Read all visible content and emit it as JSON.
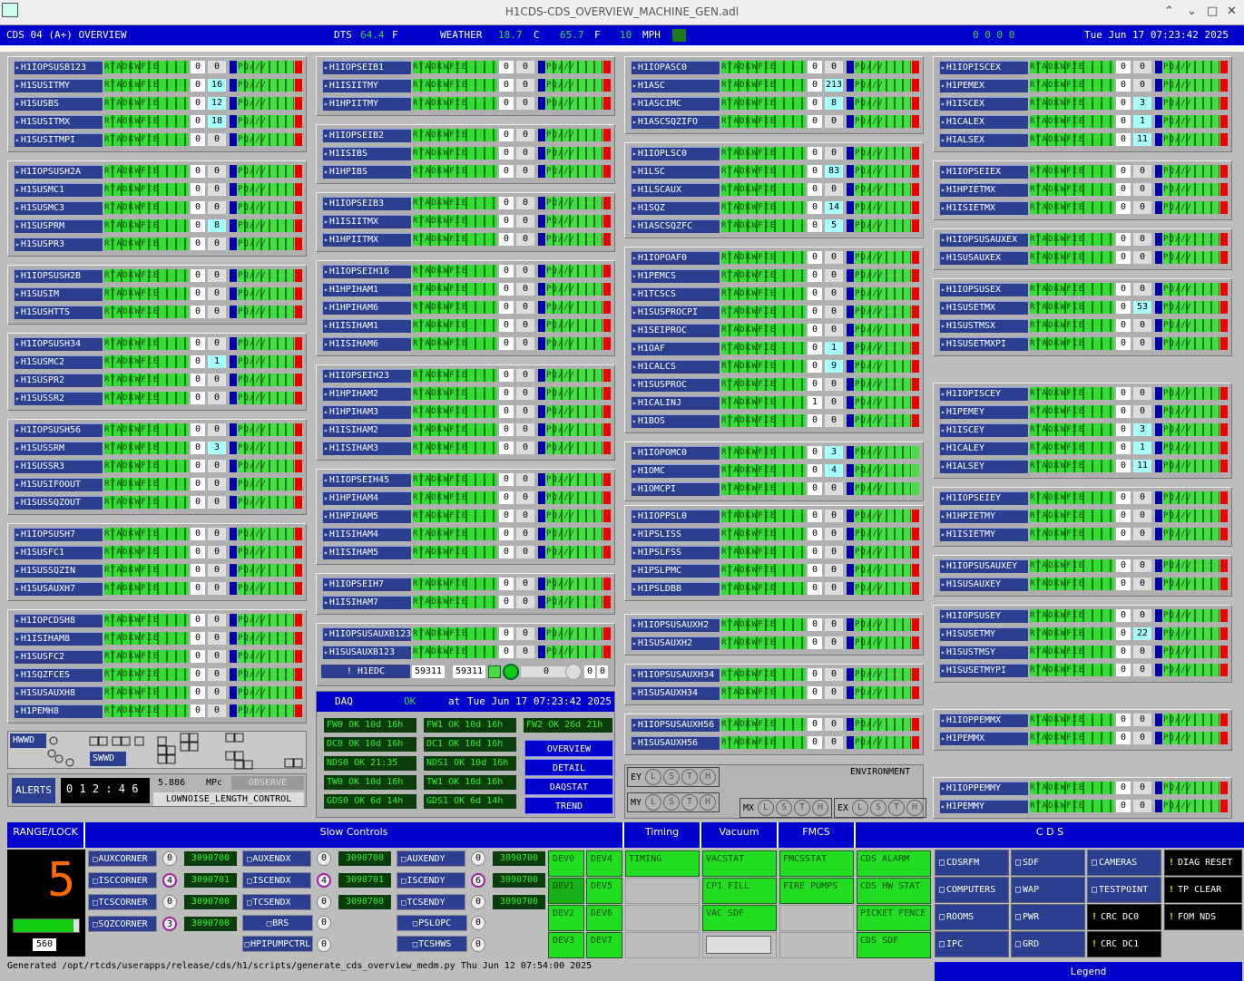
{
  "window": {
    "title": "H1CDS-CDS_OVERVIEW_MACHINE_GEN.adl",
    "ctrl": [
      "⌃",
      "⌄",
      "□",
      "✕"
    ]
  },
  "header": {
    "title": "CDS 04 (A+) OVERVIEW",
    "dts_label": "DTS",
    "dts_val": "64.4",
    "dts_unit": "F",
    "weather_label": "WEATHER",
    "w_c": "18.7",
    "w_c_unit": "C",
    "w_f": "65.7",
    "w_f_unit": "F",
    "wind": "10",
    "wind_unit": "MPH",
    "zeros": "0   0   0   0",
    "datetime": "Tue Jun 17 07:23:42 2025"
  },
  "status_letters": "RTADKWFIE",
  "daq_letters": "PQ///",
  "columns": [
    [
      {
        "rows": [
          [
            "H1IOPSUSB123",
            "0",
            "0"
          ],
          [
            "H1SUSITMY",
            "0",
            "16"
          ],
          [
            "H1SUSBS",
            "0",
            "12"
          ],
          [
            "H1SUSITMX",
            "0",
            "18"
          ],
          [
            "H1SUSITMPI",
            "0",
            "0"
          ]
        ]
      },
      {
        "rows": [
          [
            "H1IOPSUSH2A",
            "0",
            "0"
          ],
          [
            "H1SUSMC1",
            "0",
            "0"
          ],
          [
            "H1SUSMC3",
            "0",
            "0"
          ],
          [
            "H1SUSPRM",
            "0",
            "8"
          ],
          [
            "H1SUSPR3",
            "0",
            "0"
          ]
        ]
      },
      {
        "rows": [
          [
            "H1IOPSUSH2B",
            "0",
            "0"
          ],
          [
            "H1SUSIM",
            "0",
            "0"
          ],
          [
            "H1SUSHTTS",
            "0",
            "0"
          ]
        ]
      },
      {
        "rows": [
          [
            "H1IOPSUSH34",
            "0",
            "0"
          ],
          [
            "H1SUSMC2",
            "0",
            "1"
          ],
          [
            "H1SUSPR2",
            "0",
            "0"
          ],
          [
            "H1SUSSR2",
            "0",
            "0"
          ]
        ]
      },
      {
        "rows": [
          [
            "H1IOPSUSH56",
            "0",
            "0"
          ],
          [
            "H1SUSSRM",
            "0",
            "3"
          ],
          [
            "H1SUSSR3",
            "0",
            "0"
          ],
          [
            "H1SUSIFOOUT",
            "0",
            "0"
          ],
          [
            "H1SUSSQZOUT",
            "0",
            "0"
          ]
        ]
      },
      {
        "rows": [
          [
            "H1IOPSUSH7",
            "0",
            "0"
          ],
          [
            "H1SUSFC1",
            "0",
            "0"
          ],
          [
            "H1SUSSQZIN",
            "0",
            "0"
          ],
          [
            "H1SUSAUXH7",
            "0",
            "0"
          ]
        ]
      },
      {
        "rows": [
          [
            "H1IOPCDSH8",
            "0",
            "0"
          ],
          [
            "H1ISIHAM8",
            "0",
            "0"
          ],
          [
            "H1SUSFC2",
            "0",
            "0"
          ],
          [
            "H1SQZFCES",
            "0",
            "0"
          ],
          [
            "H1SUSAUXH8",
            "0",
            "0"
          ],
          [
            "H1PEMH8",
            "0",
            "0"
          ]
        ]
      }
    ],
    [
      {
        "rows": [
          [
            "H1IOPSEIB1",
            "0",
            "0"
          ],
          [
            "H1ISIITMY",
            "0",
            "0"
          ],
          [
            "H1HPIITMY",
            "0",
            "0"
          ]
        ]
      },
      {
        "rows": [
          [
            "H1IOPSEIB2",
            "0",
            "0"
          ],
          [
            "H1ISIBS",
            "0",
            "0"
          ],
          [
            "H1HPIBS",
            "0",
            "0"
          ]
        ]
      },
      {
        "rows": [
          [
            "H1IOPSEIB3",
            "0",
            "0"
          ],
          [
            "H1ISIITMX",
            "0",
            "0"
          ],
          [
            "H1HPIITMX",
            "0",
            "0"
          ]
        ]
      },
      {
        "rows": [
          [
            "H1IOPSEIH16",
            "0",
            "0"
          ],
          [
            "H1HPIHAM1",
            "0",
            "0"
          ],
          [
            "H1HPIHAM6",
            "0",
            "0"
          ],
          [
            "H1ISIHAM1",
            "0",
            "0"
          ],
          [
            "H1ISIHAM6",
            "0",
            "0"
          ]
        ]
      },
      {
        "rows": [
          [
            "H1IOPSEIH23",
            "0",
            "0"
          ],
          [
            "H1HPIHAM2",
            "0",
            "0"
          ],
          [
            "H1HPIHAM3",
            "0",
            "0"
          ],
          [
            "H1ISIHAM2",
            "0",
            "0"
          ],
          [
            "H1ISIHAM3",
            "0",
            "0"
          ]
        ]
      },
      {
        "rows": [
          [
            "H1IOPSEIH45",
            "0",
            "0"
          ],
          [
            "H1HPIHAM4",
            "0",
            "0"
          ],
          [
            "H1HPIHAM5",
            "0",
            "0"
          ],
          [
            "H1ISIHAM4",
            "0",
            "0"
          ],
          [
            "H1ISIHAM5",
            "0",
            "0"
          ]
        ]
      },
      {
        "rows": [
          [
            "H1IOPSEIH7",
            "0",
            "0"
          ],
          [
            "H1ISIHAM7",
            "0",
            "0"
          ]
        ]
      },
      {
        "rows": [
          [
            "H1IOPSUSAUXB123",
            "0",
            "0"
          ],
          [
            "H1SUSAUXB123",
            "0",
            "0"
          ]
        ]
      }
    ],
    [
      {
        "rows": [
          [
            "H1IOPASC0",
            "0",
            "0"
          ],
          [
            "H1ASC",
            "0",
            "213"
          ],
          [
            "H1ASCIMC",
            "0",
            "8"
          ],
          [
            "H1ASCSQZIFO",
            "0",
            "0"
          ]
        ]
      },
      {
        "rows": [
          [
            "H1IOPLSC0",
            "0",
            "0"
          ],
          [
            "H1LSC",
            "0",
            "83"
          ],
          [
            "H1LSCAUX",
            "0",
            "0"
          ],
          [
            "H1SQZ",
            "0",
            "14"
          ],
          [
            "H1ASCSQZFC",
            "0",
            "5"
          ]
        ]
      },
      {
        "rows": [
          [
            "H1IOPOAF0",
            "0",
            "0"
          ],
          [
            "H1PEMCS",
            "0",
            "0"
          ],
          [
            "H1TCSCS",
            "0",
            "0"
          ],
          [
            "H1SUSPROCPI",
            "0",
            "0"
          ],
          [
            "H1SEIPROC",
            "0",
            "0"
          ],
          [
            "H1OAF",
            "0",
            "1"
          ],
          [
            "H1CALCS",
            "0",
            "9"
          ],
          [
            "H1SUSPROC",
            "0",
            "0"
          ],
          [
            "H1CALINJ",
            "1",
            "0"
          ],
          [
            "H1BOS",
            "0",
            "0"
          ]
        ]
      },
      {
        "rows": [
          [
            "H1IOPOMC0",
            "0",
            "3"
          ],
          [
            "H1OMC",
            "0",
            "4"
          ],
          [
            "H1OMCPI",
            "0",
            "0"
          ]
        ]
      },
      {
        "rows": [
          [
            "H1IOPPSL0",
            "0",
            "0"
          ],
          [
            "H1PSLISS",
            "0",
            "0"
          ],
          [
            "H1PSLFSS",
            "0",
            "0"
          ],
          [
            "H1PSLPMC",
            "0",
            "0"
          ],
          [
            "H1PSLDBB",
            "0",
            "0"
          ]
        ]
      },
      {
        "rows": [
          [
            "H1IOPSUSAUXH2",
            "0",
            "0"
          ],
          [
            "H1SUSAUXH2",
            "0",
            "0"
          ]
        ]
      },
      {
        "rows": [
          [
            "H1IOPSUSAUXH34",
            "0",
            "0"
          ],
          [
            "H1SUSAUXH34",
            "0",
            "0"
          ]
        ]
      },
      {
        "rows": [
          [
            "H1IOPSUSAUXH56",
            "0",
            "0"
          ],
          [
            "H1SUSAUXH56",
            "0",
            "0"
          ]
        ]
      }
    ],
    [
      {
        "rows": [
          [
            "H1IOPISCEX",
            "0",
            "0"
          ],
          [
            "H1PEMEX",
            "0",
            "0"
          ],
          [
            "H1ISCEX",
            "0",
            "3"
          ],
          [
            "H1CALEX",
            "0",
            "1"
          ],
          [
            "H1ALSEX",
            "0",
            "11"
          ]
        ]
      },
      {
        "rows": [
          [
            "H1IOPSEIEX",
            "0",
            "0"
          ],
          [
            "H1HPIETMX",
            "0",
            "0"
          ],
          [
            "H1ISIETMX",
            "0",
            "0"
          ]
        ]
      },
      {
        "rows": [
          [
            "H1IOPSUSAUXEX",
            "0",
            "0"
          ],
          [
            "H1SUSAUXEX",
            "0",
            "0"
          ]
        ]
      },
      {
        "rows": [
          [
            "H1IOPSUSEX",
            "0",
            "0"
          ],
          [
            "H1SUSETMX",
            "0",
            "53"
          ],
          [
            "H1SUSTMSX",
            "0",
            "0"
          ],
          [
            "H1SUSETMXPI",
            "0",
            "0"
          ]
        ]
      },
      {
        "rows": [
          [
            "H1IOPISCEY",
            "0",
            "0"
          ],
          [
            "H1PEMEY",
            "0",
            "0"
          ],
          [
            "H1ISCEY",
            "0",
            "3"
          ],
          [
            "H1CALEY",
            "0",
            "1"
          ],
          [
            "H1ALSEY",
            "0",
            "11"
          ]
        ]
      },
      {
        "rows": [
          [
            "H1IOPSEIEY",
            "0",
            "0"
          ],
          [
            "H1HPIETMY",
            "0",
            "0"
          ],
          [
            "H1ISIETMY",
            "0",
            "0"
          ]
        ]
      },
      {
        "rows": [
          [
            "H1IOPSUSAUXEY",
            "0",
            "0"
          ],
          [
            "H1SUSAUXEY",
            "0",
            "0"
          ]
        ]
      },
      {
        "rows": [
          [
            "H1IOPSUSEY",
            "0",
            "0"
          ],
          [
            "H1SUSETMY",
            "0",
            "22"
          ],
          [
            "H1SUSTMSY",
            "0",
            "0"
          ],
          [
            "H1SUSETMYPI",
            "0",
            "0"
          ]
        ]
      },
      {
        "rows": [
          [
            "H1IOPPEMMX",
            "0",
            "0"
          ],
          [
            "H1PEMMX",
            "0",
            "0"
          ]
        ]
      },
      {
        "rows": [
          [
            "H1IOPPEMMY",
            "0",
            "0"
          ],
          [
            "H1PEMMY",
            "0",
            "0"
          ]
        ]
      }
    ]
  ],
  "edc": {
    "label": "! H1EDC",
    "v1": "59311",
    "v2": "59311",
    "v3": "0",
    "v4": "0",
    "v5": "0"
  },
  "daq": {
    "label": "DAQ",
    "status": "OK",
    "at": "at",
    "time": "Tue Jun 17 07:23:42 2025",
    "cells": [
      "FW0 OK  10d 16h",
      "FW1 OK  10d 16h",
      "FW2 OK  26d 21h",
      "DC0 OK  10d 16h",
      "DC1 OK  10d 16h",
      "NDS0 OK     21:35",
      "NDS1 OK  10d 16h",
      "TW0 OK  10d 16h",
      "TW1 OK  10d 16h",
      "GDS0 OK   6d 14h",
      "GDS1 OK   6d 14h"
    ],
    "buttons": [
      "OVERVIEW",
      "DETAIL",
      "DAQSTAT",
      "TREND"
    ]
  },
  "hwwd": {
    "label": "HWWD",
    "swwd": "SWWD"
  },
  "alerts": {
    "label": "ALERTS",
    "counter": "0 1 2 : 4 6",
    "mpc_val": "5.886",
    "mpc_unit": "MPc",
    "observe": "OBSERVE",
    "state": "LOWNOISE_LENGTH_CONTROL"
  },
  "env": {
    "ey": "EY",
    "my": "MY",
    "mx": "MX",
    "ex": "EX",
    "title": "ENVIRONMENT",
    "lst": [
      "L",
      "S",
      "T",
      "H"
    ]
  },
  "bottom": {
    "range_lock": "RANGE/LOCK",
    "lock_digit": "5",
    "lock_num": "560",
    "slow_controls": "Slow Controls",
    "timing": "Timing",
    "vacuum": "Vacuum",
    "fmcs": "FMCS",
    "cds": "C D S",
    "sc": [
      [
        "AUXCORNER",
        "0",
        "3090700"
      ],
      [
        "ISCCORNER",
        "4",
        "3090701"
      ],
      [
        "TCSCORNER",
        "0",
        "3090700"
      ],
      [
        "SQZCORNER",
        "3",
        "3090700"
      ],
      [
        "AUXENDX",
        "0",
        "3090700"
      ],
      [
        "ISCENDX",
        "4",
        "3090701"
      ],
      [
        "TCSENDX",
        "0",
        "3090700"
      ],
      [
        "AUXENDY",
        "0",
        "3090700"
      ],
      [
        "ISCENDY",
        "6",
        "3090700"
      ],
      [
        "TCSENDY",
        "0",
        "3090700"
      ]
    ],
    "brs": "BRS",
    "brs_v": "0",
    "hpipump": "HPIPUMPCTRL",
    "hpipump_v": "0",
    "pslopc": "PSLOPC",
    "pslopc_v": "0",
    "tcshws": "TCSHWS",
    "tcshws_v": "0",
    "devs": [
      "DEV0",
      "DEV4",
      "DEV1",
      "DEV5",
      "DEV2",
      "DEV6",
      "DEV3",
      "DEV7"
    ],
    "timing_box": "TIMING",
    "vac": [
      "VACSTAT",
      "CP1 FILL",
      "VAC SDF"
    ],
    "fm": [
      "FMCSSTAT",
      "FIRE PUMPS"
    ],
    "cdsg": [
      "CDS ALARM",
      "CDS HW STAT",
      "PICKET FENCE",
      "CDS SDF"
    ],
    "cdsb": [
      "CDSRFM",
      "SDF",
      "CAMERAS",
      "COMPUTERS",
      "WAP",
      "TESTPOINT",
      "ROOMS",
      "PWR",
      "IPC",
      "GRD"
    ],
    "cdsk": [
      "DIAG RESET",
      "TP CLEAR",
      "FOM NDS",
      "CRC DC0",
      "CRC DC1"
    ]
  },
  "footer": "Generated /opt/rtcds/userapps/release/cds/h1/scripts/generate_cds_overview_medm.py Thu Jun 12 07:54:00 2025",
  "legend": "Legend"
}
